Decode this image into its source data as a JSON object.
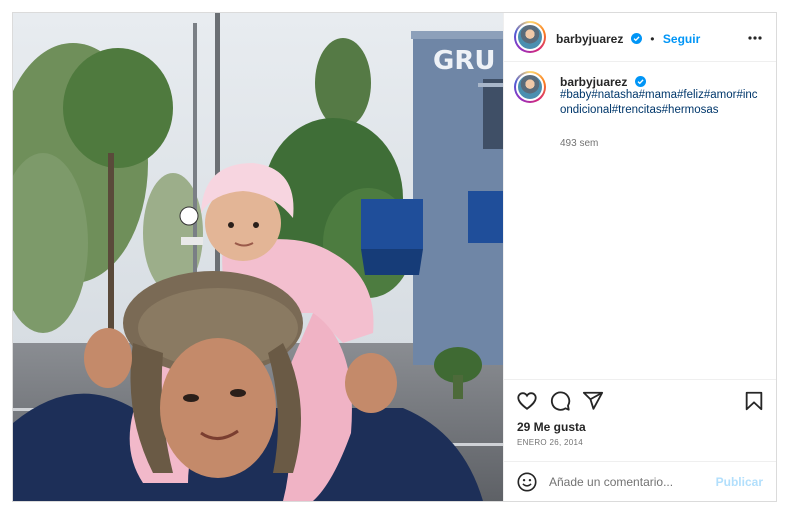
{
  "post": {
    "username": "barbyjuarez",
    "follow_label": "Seguir",
    "separator": "•",
    "caption": "#baby#natasha#mama#feliz#amor#incondicional#trencitas#hermosas",
    "time_ago": "493 sem",
    "likes": "29 Me gusta",
    "date": "ENERO 26, 2014",
    "photo_sign_text": "GRU"
  },
  "comment": {
    "placeholder": "Añade un comentario...",
    "publish_label": "Publicar"
  },
  "icons": {
    "verified": "verified-badge-icon",
    "more": "more-options-icon",
    "like": "heart-icon",
    "comment": "comment-icon",
    "share": "share-icon",
    "save": "bookmark-icon",
    "emoji": "emoji-icon"
  },
  "colors": {
    "link": "#00376b",
    "follow": "#0095f6",
    "verified": "#0095f6",
    "publish_disabled": "#b2dffc",
    "muted": "#737373",
    "border": "#dbdbdb"
  }
}
